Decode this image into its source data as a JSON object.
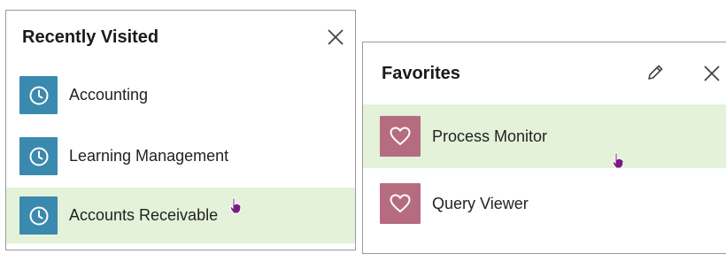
{
  "recently_visited": {
    "title": "Recently Visited",
    "close_icon": "close-icon",
    "items": [
      {
        "label": "Accounting",
        "icon": "clock-icon",
        "highlighted": false
      },
      {
        "label": "Learning Management",
        "icon": "clock-icon",
        "highlighted": false
      },
      {
        "label": "Accounts Receivable",
        "icon": "clock-icon",
        "highlighted": true
      }
    ]
  },
  "favorites": {
    "title": "Favorites",
    "edit_icon": "pencil-icon",
    "close_icon": "close-icon",
    "items": [
      {
        "label": "Process Monitor",
        "icon": "heart-icon",
        "highlighted": true
      },
      {
        "label": "Query Viewer",
        "icon": "heart-icon",
        "highlighted": false
      }
    ]
  },
  "colors": {
    "clock_tile": "#3a89ae",
    "heart_tile": "#b66c80",
    "highlight": "#e3f2d8",
    "cursor": "#7a1b84"
  }
}
